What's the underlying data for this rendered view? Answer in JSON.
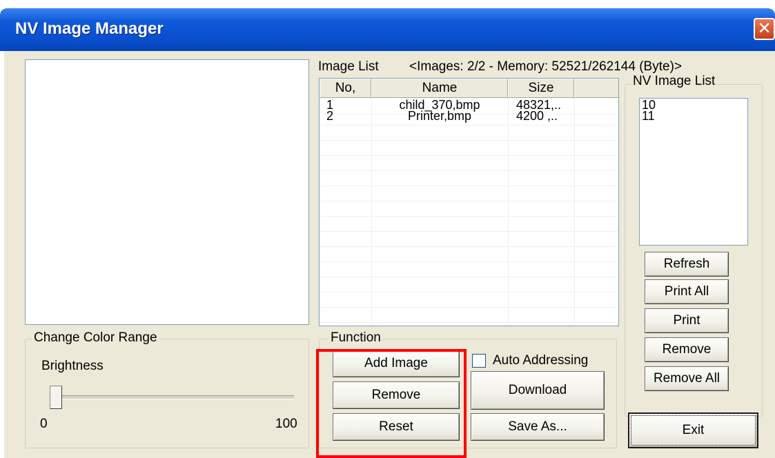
{
  "window": {
    "title": "NV Image Manager",
    "close_label": "✕"
  },
  "image_list": {
    "label": "Image List",
    "info": "<Images: 2/2 - Memory: 52521/262144 (Byte)>",
    "columns": [
      "No,",
      "Name",
      "Size"
    ],
    "rows": [
      {
        "no": "1",
        "name": "child_370,bmp",
        "size": "48321,.."
      },
      {
        "no": "2",
        "name": "Printer,bmp",
        "size": "4200 ,.."
      }
    ]
  },
  "nv_image_list": {
    "title": "NV Image List",
    "items": [
      "10",
      "11"
    ],
    "buttons": {
      "refresh": "Refresh",
      "print_all": "Print All",
      "print": "Print",
      "remove": "Remove",
      "remove_all": "Remove All"
    }
  },
  "color_range": {
    "title": "Change Color Range",
    "brightness_label": "Brightness",
    "min_label": "0",
    "max_label": "100",
    "brightness_value": 0
  },
  "function": {
    "title": "Function",
    "add_image": "Add Image",
    "remove": "Remove",
    "reset": "Reset",
    "auto_addressing": "Auto Addressing",
    "auto_addressing_checked": false,
    "download": "Download",
    "save_as": "Save As..."
  },
  "exit_label": "Exit",
  "colors": {
    "titlebar": "#0a4fd0",
    "highlight": "#ff0000",
    "background": "#ece9d8"
  }
}
